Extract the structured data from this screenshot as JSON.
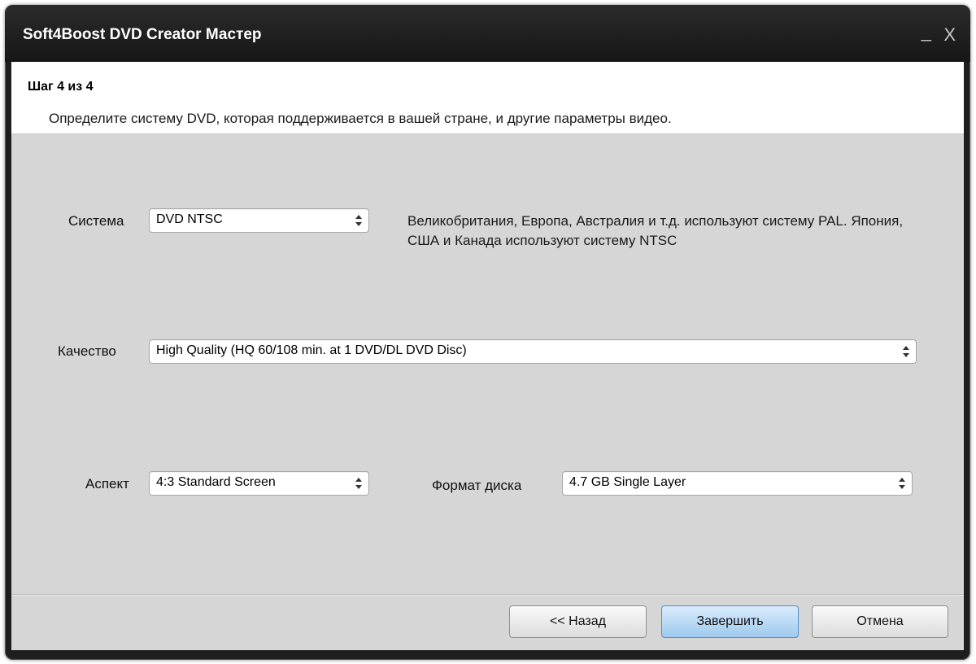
{
  "window": {
    "title": "Soft4Boost DVD Creator Мастер",
    "minimize_glyph": "_",
    "close_glyph": "X"
  },
  "header": {
    "step": "Шаг 4 из 4",
    "description": "Определите систему DVD, которая поддерживается в вашей стране, и другие параметры видео."
  },
  "form": {
    "system": {
      "label": "Система",
      "value": "DVD NTSC",
      "note": "Великобритания, Европа, Австралия и т.д. используют систему PAL. Япония, США и Канада используют систему NTSC"
    },
    "quality": {
      "label": "Качество",
      "value": "High Quality (HQ 60/108 min. at 1 DVD/DL DVD Disc)"
    },
    "aspect": {
      "label": "Аспект",
      "value": "4:3 Standard Screen"
    },
    "disc_format": {
      "label": "Формат диска",
      "value": "4.7 GB Single Layer"
    }
  },
  "buttons": {
    "back": "<< Назад",
    "finish": "Завершить",
    "cancel": "Отмена"
  },
  "icons": {
    "select_arrows": "up-down-arrows-icon"
  }
}
